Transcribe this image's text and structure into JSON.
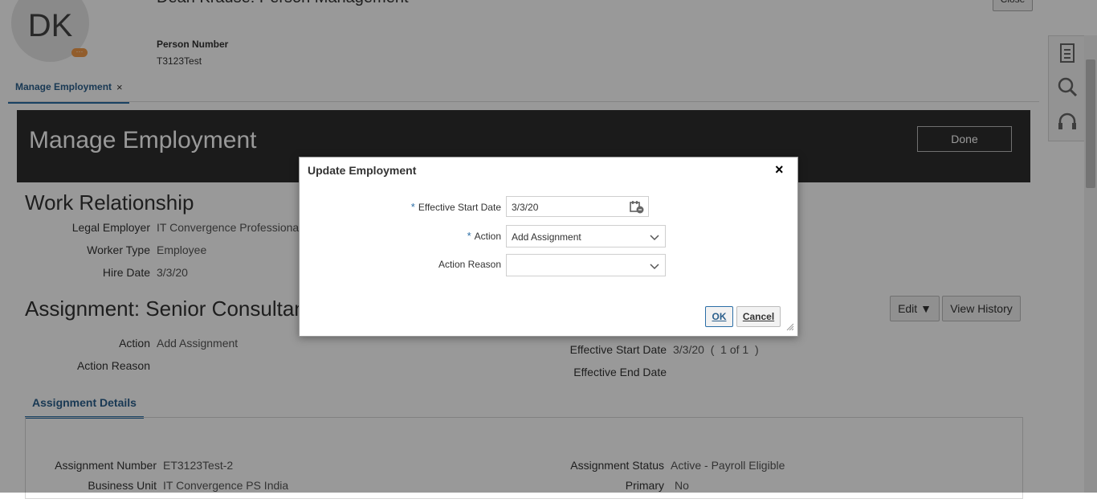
{
  "header": {
    "avatar_initials": "DK",
    "avatar_badge": "···",
    "title": "Dean Krause: Person Management",
    "top_button": "Close",
    "person_number_label": "Person Number",
    "person_number_value": "T3123Test"
  },
  "tab": {
    "label": "Manage Employment",
    "close": "×"
  },
  "banner": {
    "title": "Manage Employment",
    "done_label": "Done"
  },
  "work_relationship": {
    "title": "Work Relationship",
    "rows": [
      {
        "label": "Legal Employer",
        "value": "IT Convergence Professiona"
      },
      {
        "label": "Worker Type",
        "value": "Employee"
      },
      {
        "label": "Hire Date",
        "value": "3/3/20"
      }
    ]
  },
  "assignment": {
    "title": "Assignment: Senior Consultant",
    "edit_label": "Edit ▼",
    "view_history_label": "View History",
    "action_label": "Action",
    "action_value": "Add Assignment",
    "action_reason_label": "Action Reason",
    "eff_start_label": "Effective Start Date",
    "eff_start_value": "3/3/20  (  1 of 1  )",
    "eff_end_label": "Effective End Date"
  },
  "assignment_details": {
    "tab_label": "Assignment Details",
    "number_label": "Assignment Number",
    "number_value": "ET3123Test-2",
    "bu_label": "Business Unit",
    "bu_value": "IT Convergence PS India",
    "status_label": "Assignment Status",
    "status_value": "Active - Payroll Eligible",
    "primary_label": "Primary",
    "primary_value": "No"
  },
  "dialog": {
    "title": "Update Employment",
    "close": "×",
    "required_mark": "*",
    "start_date_label": "Effective Start Date",
    "start_date_value": "3/3/20",
    "action_label": "Action",
    "action_value": "Add Assignment",
    "action_reason_label": "Action Reason",
    "action_reason_value": "",
    "ok_label": "OK",
    "cancel_label": "Cancel"
  },
  "icons": [
    "document-icon",
    "search-icon",
    "headset-icon",
    "calendar-icon",
    "chevron-down-icon",
    "close-icon"
  ]
}
